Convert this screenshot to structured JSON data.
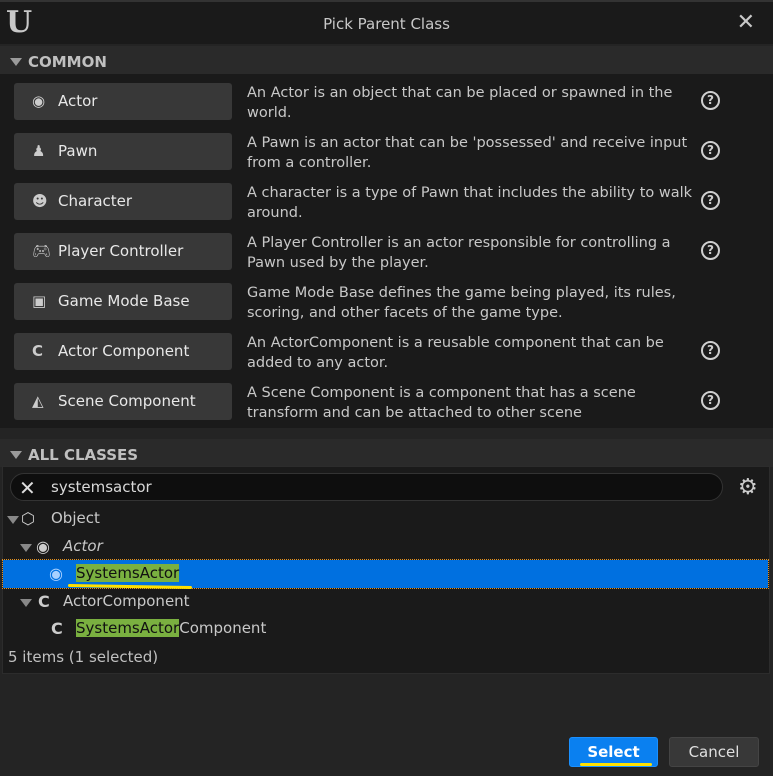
{
  "window": {
    "title": "Pick Parent Class",
    "logo": "U"
  },
  "common": {
    "header": "COMMON",
    "items": [
      {
        "label": "Actor",
        "icon": "actor-icon",
        "description": "An Actor is an object that can be placed or spawned in the world.",
        "help": true
      },
      {
        "label": "Pawn",
        "icon": "pawn-icon",
        "description": "A Pawn is an actor that can be 'possessed' and receive input from a controller.",
        "help": true
      },
      {
        "label": "Character",
        "icon": "character-icon",
        "description": "A character is a type of Pawn that includes the ability to walk around.",
        "help": true
      },
      {
        "label": "Player Controller",
        "icon": "gamepad-icon",
        "description": "A Player Controller is an actor responsible for controlling a Pawn used by the player.",
        "help": true
      },
      {
        "label": "Game Mode Base",
        "icon": "game-mode-icon",
        "description": "Game Mode Base defines the game being played, its rules, scoring, and other facets of the game type.",
        "help": false
      },
      {
        "label": "Actor Component",
        "icon": "component-icon",
        "description": "An ActorComponent is a reusable component that can be added to any actor.",
        "help": true
      },
      {
        "label": "Scene Component",
        "icon": "scene-component-icon",
        "description": "A Scene Component is a component that has a scene transform and can be attached to other scene",
        "help": true
      }
    ]
  },
  "all_classes": {
    "header": "ALL CLASSES",
    "search_value": "systemsactor",
    "tree": [
      {
        "label": "Object",
        "hl": "",
        "rest": "Object",
        "depth": 0,
        "expanded": true,
        "italic": false
      },
      {
        "label": "Actor",
        "hl": "",
        "rest": "Actor",
        "depth": 1,
        "expanded": true,
        "italic": true
      },
      {
        "label": "SystemsActor",
        "hl": "SystemsActor",
        "rest": "",
        "depth": 2,
        "selected": true
      },
      {
        "label": "ActorComponent",
        "hl": "",
        "rest": "ActorComponent",
        "depth": 1,
        "expanded": true
      },
      {
        "label": "SystemsActorComponent",
        "hl": "SystemsActor",
        "rest": "Component",
        "depth": 2
      }
    ],
    "status": "5 items (1 selected)"
  },
  "buttons": {
    "select": "Select",
    "cancel": "Cancel"
  },
  "colors": {
    "accent": "#0a80f0",
    "selection": "#0070e0",
    "match_highlight": "#7ab040",
    "annotation": "#ffe000"
  }
}
